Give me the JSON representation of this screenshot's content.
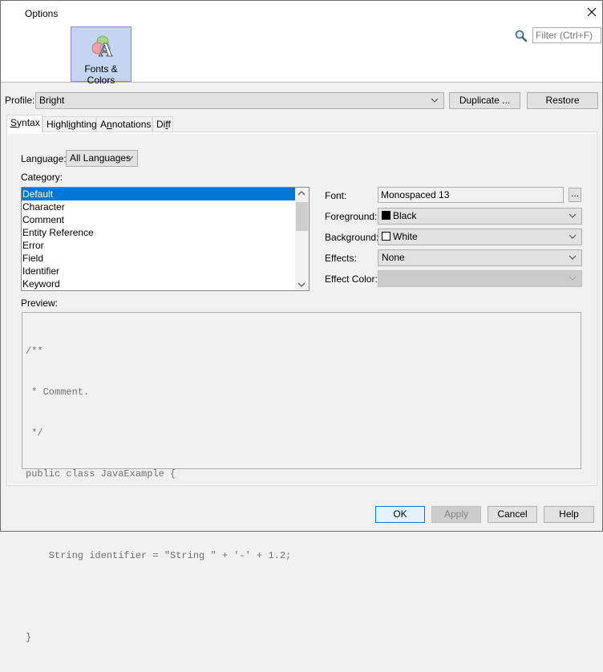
{
  "window": {
    "title": "Options",
    "close_icon": "close-icon"
  },
  "categories": [
    {
      "label": "Fonts & Colors",
      "icon": "fonts-colors-icon",
      "selected": true
    }
  ],
  "search": {
    "icon": "magnifier-icon",
    "placeholder": "Filter (Ctrl+F)"
  },
  "profile": {
    "label": "Profile:",
    "value": "Bright",
    "duplicate_label": "Duplicate ...",
    "restore_label": "Restore"
  },
  "tabs": [
    {
      "label_pre": "",
      "mnemonic": "S",
      "label_post": "yntax",
      "active": true
    },
    {
      "label_pre": "Highl",
      "mnemonic": "i",
      "label_post": "ghting",
      "active": false
    },
    {
      "label_pre": "A",
      "mnemonic": "n",
      "label_post": "notations",
      "active": false
    },
    {
      "label_pre": "Di",
      "mnemonic": "f",
      "label_post": "f",
      "active": false
    }
  ],
  "syntax": {
    "language_label": "Language:",
    "language_value": "All Languages",
    "category_label": "Category:",
    "category_items": [
      "Default",
      "Character",
      "Comment",
      "Entity Reference",
      "Error",
      "Field",
      "Identifier",
      "Keyword"
    ],
    "selected_category": "Default",
    "font_label": "Font:",
    "font_value": "Monospaced 13",
    "font_browse_label": "...",
    "foreground_label": "Foreground:",
    "foreground_value": "Black",
    "foreground_color": "#000000",
    "background_label": "Background:",
    "background_value": "White",
    "background_color": "#ffffff",
    "effects_label": "Effects:",
    "effects_value": "None",
    "effect_color_label": "Effect Color:",
    "effect_color_value": "",
    "preview_label": "Preview:",
    "preview_lines": [
      "/**",
      " * Comment.",
      " */",
      "public class JavaExample {",
      "",
      "    String identifier = \"String \" + '-' + 1.2;",
      "",
      "}"
    ]
  },
  "footer": {
    "ok_label": "OK",
    "apply_label": "Apply",
    "cancel_label": "Cancel",
    "help_label": "Help"
  },
  "colors": {
    "selection": "#0078d7",
    "category_selected_bg": "#c5d5ef"
  }
}
